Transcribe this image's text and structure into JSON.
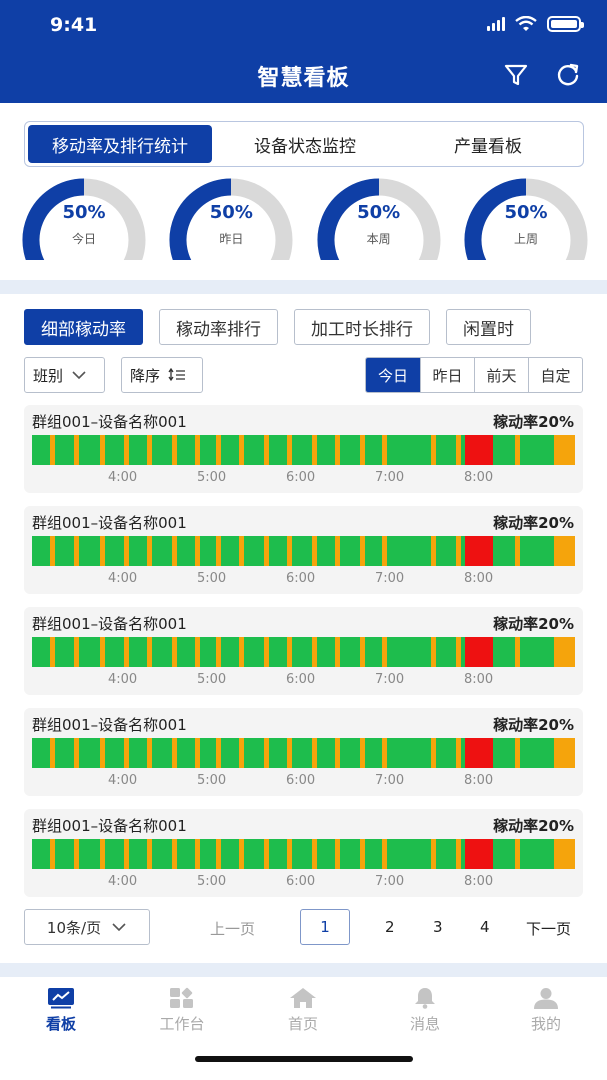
{
  "status": {
    "time": "9:41"
  },
  "header": {
    "title": "智慧看板",
    "icons": [
      "filter-icon",
      "refresh-icon"
    ]
  },
  "top_tabs": [
    "移动率及排行统计",
    "设备状态监控",
    "产量看板"
  ],
  "top_tab_active": 0,
  "gauges": [
    {
      "value": "50%",
      "label": "今日",
      "fraction": 0.5
    },
    {
      "value": "50%",
      "label": "昨日",
      "fraction": 0.5
    },
    {
      "value": "50%",
      "label": "本周",
      "fraction": 0.5
    },
    {
      "value": "50%",
      "label": "上周",
      "fraction": 0.5
    }
  ],
  "sub_tabs": [
    "细部稼动率",
    "稼动率排行",
    "加工时长排行",
    "闲置时"
  ],
  "sub_tab_active": 0,
  "filters": {
    "shift": "班别",
    "sort": "降序"
  },
  "date_buttons": [
    "今日",
    "昨日",
    "前天",
    "自定"
  ],
  "date_active": 0,
  "timeline_ticks": [
    "4:00",
    "5:00",
    "6:00",
    "7:00",
    "8:00"
  ],
  "devices": [
    {
      "name": "群组001–设备名称001",
      "rate": "稼动率20%"
    },
    {
      "name": "群组001–设备名称001",
      "rate": "稼动率20%"
    },
    {
      "name": "群组001–设备名称001",
      "rate": "稼动率20%"
    },
    {
      "name": "群组001–设备名称001",
      "rate": "稼动率20%"
    },
    {
      "name": "群组001–设备名称001",
      "rate": "稼动率20%"
    }
  ],
  "pagination": {
    "page_size": "10条/页",
    "prev": "上一页",
    "current": "1",
    "pages": [
      "2",
      "3",
      "4"
    ],
    "next": "下一页"
  },
  "bottom_nav": [
    {
      "label": "看板",
      "icon": "chart-icon",
      "active": true
    },
    {
      "label": "工作台",
      "icon": "grid-icon",
      "active": false
    },
    {
      "label": "首页",
      "icon": "home-icon",
      "active": false
    },
    {
      "label": "消息",
      "icon": "bell-icon",
      "active": false
    },
    {
      "label": "我的",
      "icon": "user-icon",
      "active": false
    }
  ],
  "colors": {
    "primary": "#0f3fa6",
    "running": "#1ebd4d",
    "idle": "#f5a40c",
    "alarm": "#ee1111",
    "gauge_track": "#d9d9d9"
  }
}
